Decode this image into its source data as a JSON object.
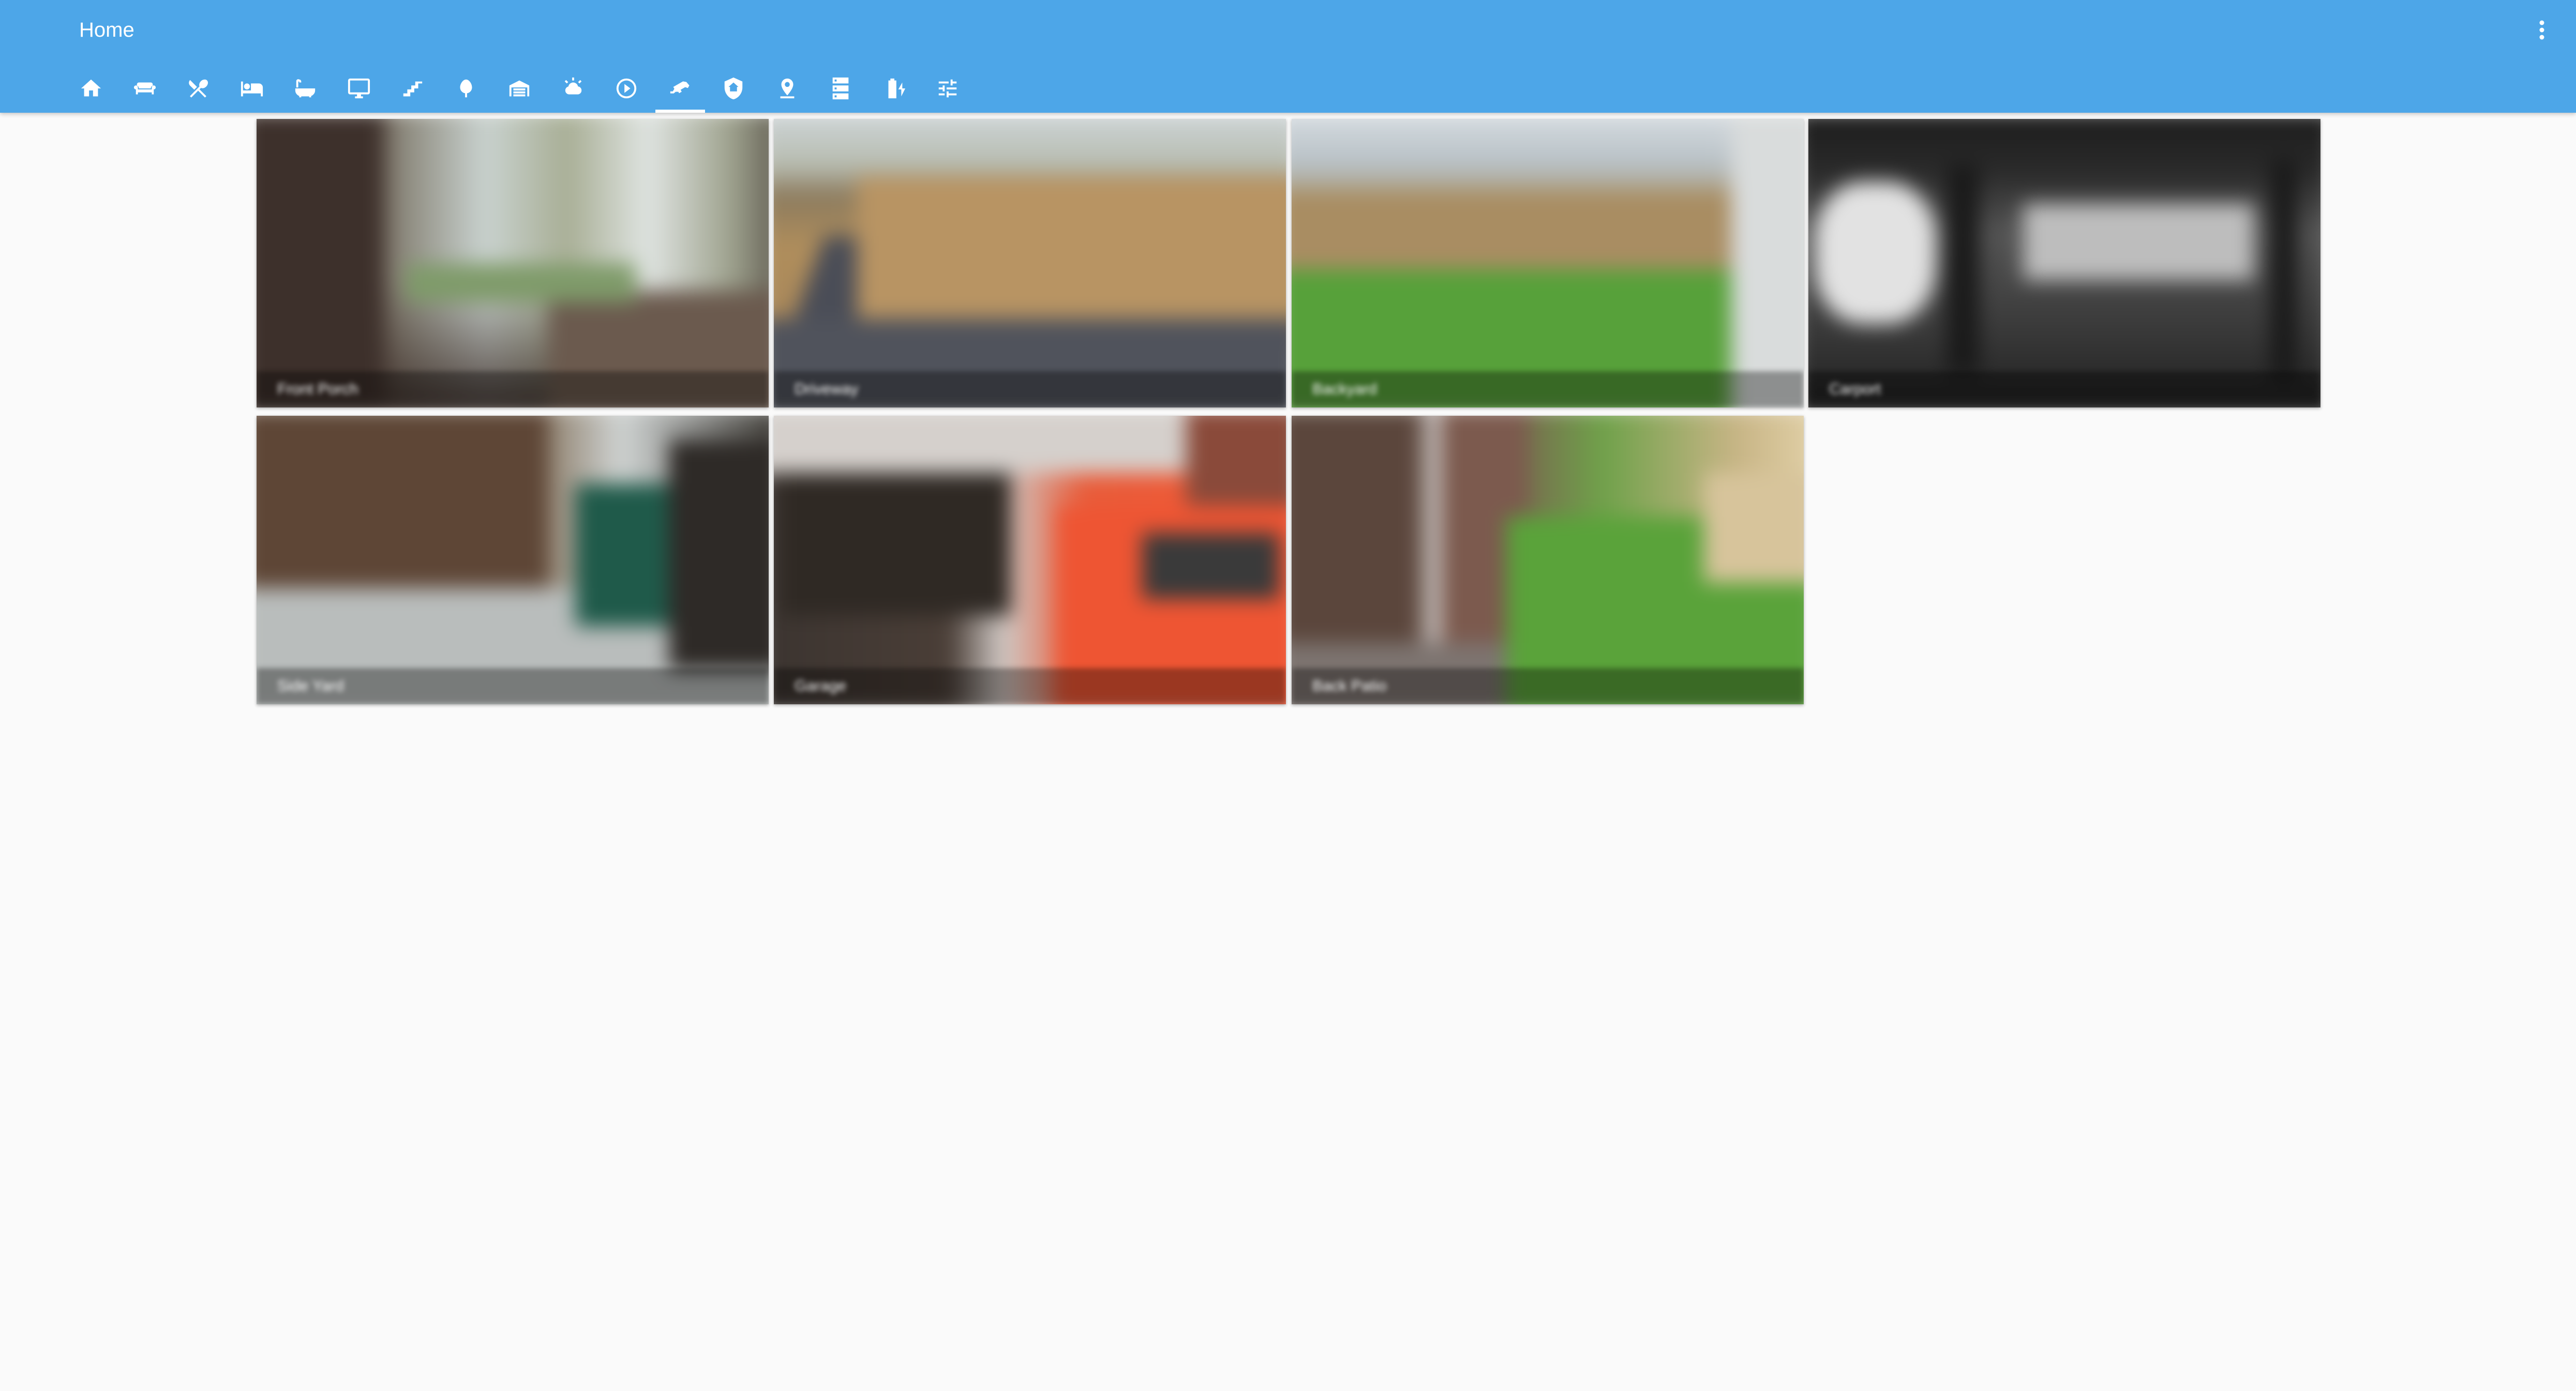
{
  "header": {
    "title": "Home",
    "background_color": "#4da6e8",
    "menu_icon": "dots-vertical-icon"
  },
  "tabs": [
    {
      "icon": "home-icon",
      "active": false
    },
    {
      "icon": "sofa-icon",
      "active": false
    },
    {
      "icon": "silverware-icon",
      "active": false
    },
    {
      "icon": "bed-icon",
      "active": false
    },
    {
      "icon": "bathtub-icon",
      "active": false
    },
    {
      "icon": "monitor-icon",
      "active": false
    },
    {
      "icon": "stairs-icon",
      "active": false
    },
    {
      "icon": "tree-icon",
      "active": false
    },
    {
      "icon": "garage-icon",
      "active": false
    },
    {
      "icon": "weather-icon",
      "active": false
    },
    {
      "icon": "play-circle-icon",
      "active": false
    },
    {
      "icon": "cctv-icon",
      "active": true
    },
    {
      "icon": "shield-home-icon",
      "active": false
    },
    {
      "icon": "map-marker-icon",
      "active": false
    },
    {
      "icon": "server-icon",
      "active": false
    },
    {
      "icon": "battery-charging-icon",
      "active": false
    },
    {
      "icon": "tune-icon",
      "active": false
    }
  ],
  "cameras": [
    {
      "caption": "Front Porch"
    },
    {
      "caption": "Driveway"
    },
    {
      "caption": "Backyard"
    },
    {
      "caption": "Carport"
    },
    {
      "caption": "Side Yard"
    },
    {
      "caption": "Garage"
    },
    {
      "caption": "Back Patio"
    }
  ]
}
